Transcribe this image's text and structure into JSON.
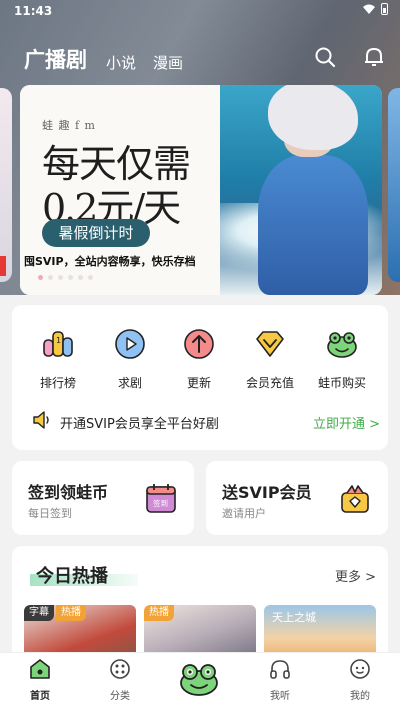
{
  "status_bar": {
    "time": "11:43"
  },
  "top_nav": {
    "tabs": [
      "广播剧",
      "小说",
      "漫画"
    ],
    "active_tab": "广播剧"
  },
  "banner": {
    "brand": "蛙 趣 f m",
    "line1": "每天仅需",
    "line2": "0.2元/天",
    "button": "暑假倒计时",
    "tagline": "囤SVIP，全站内容畅享，快乐存档",
    "pages": 6,
    "active_page": 1
  },
  "categories": [
    {
      "label": "排行榜",
      "icon": "ranking-icon"
    },
    {
      "label": "求剧",
      "icon": "request-icon"
    },
    {
      "label": "更新",
      "icon": "update-icon"
    },
    {
      "label": "会员充值",
      "icon": "vip-recharge-icon"
    },
    {
      "label": "蛙币购买",
      "icon": "frog-coin-icon"
    }
  ],
  "svip_promo": {
    "text": "开通SVIP会员享全平台好剧",
    "action": "立即开通 >"
  },
  "cards": [
    {
      "title": "签到领蛙币",
      "subtitle": "每日签到",
      "icon": "calendar-icon",
      "icon_text": "签到"
    },
    {
      "title": "送SVIP会员",
      "subtitle": "邀请用户",
      "icon": "gift-icon"
    }
  ],
  "hot_today": {
    "title": "今日热播",
    "more": "更多 >",
    "items": [
      {
        "badges": [
          "字幕",
          "热播"
        ]
      },
      {
        "badges": [
          "热播"
        ]
      },
      {
        "badges": [],
        "art_text": "天上之城"
      }
    ]
  },
  "tab_bar": [
    {
      "label": "首页",
      "icon": "home-icon",
      "active": true
    },
    {
      "label": "分类",
      "icon": "category-icon",
      "active": false
    },
    {
      "label": "",
      "icon": "frog-icon",
      "active": false
    },
    {
      "label": "我听",
      "icon": "headphones-icon",
      "active": false
    },
    {
      "label": "我的",
      "icon": "profile-icon",
      "active": false
    }
  ],
  "colors": {
    "accent_green": "#3fae4a",
    "countdown_bg": "#2a5f6d",
    "hot_badge": "#f2a338",
    "subtitle_badge": "#3a3a3a"
  }
}
